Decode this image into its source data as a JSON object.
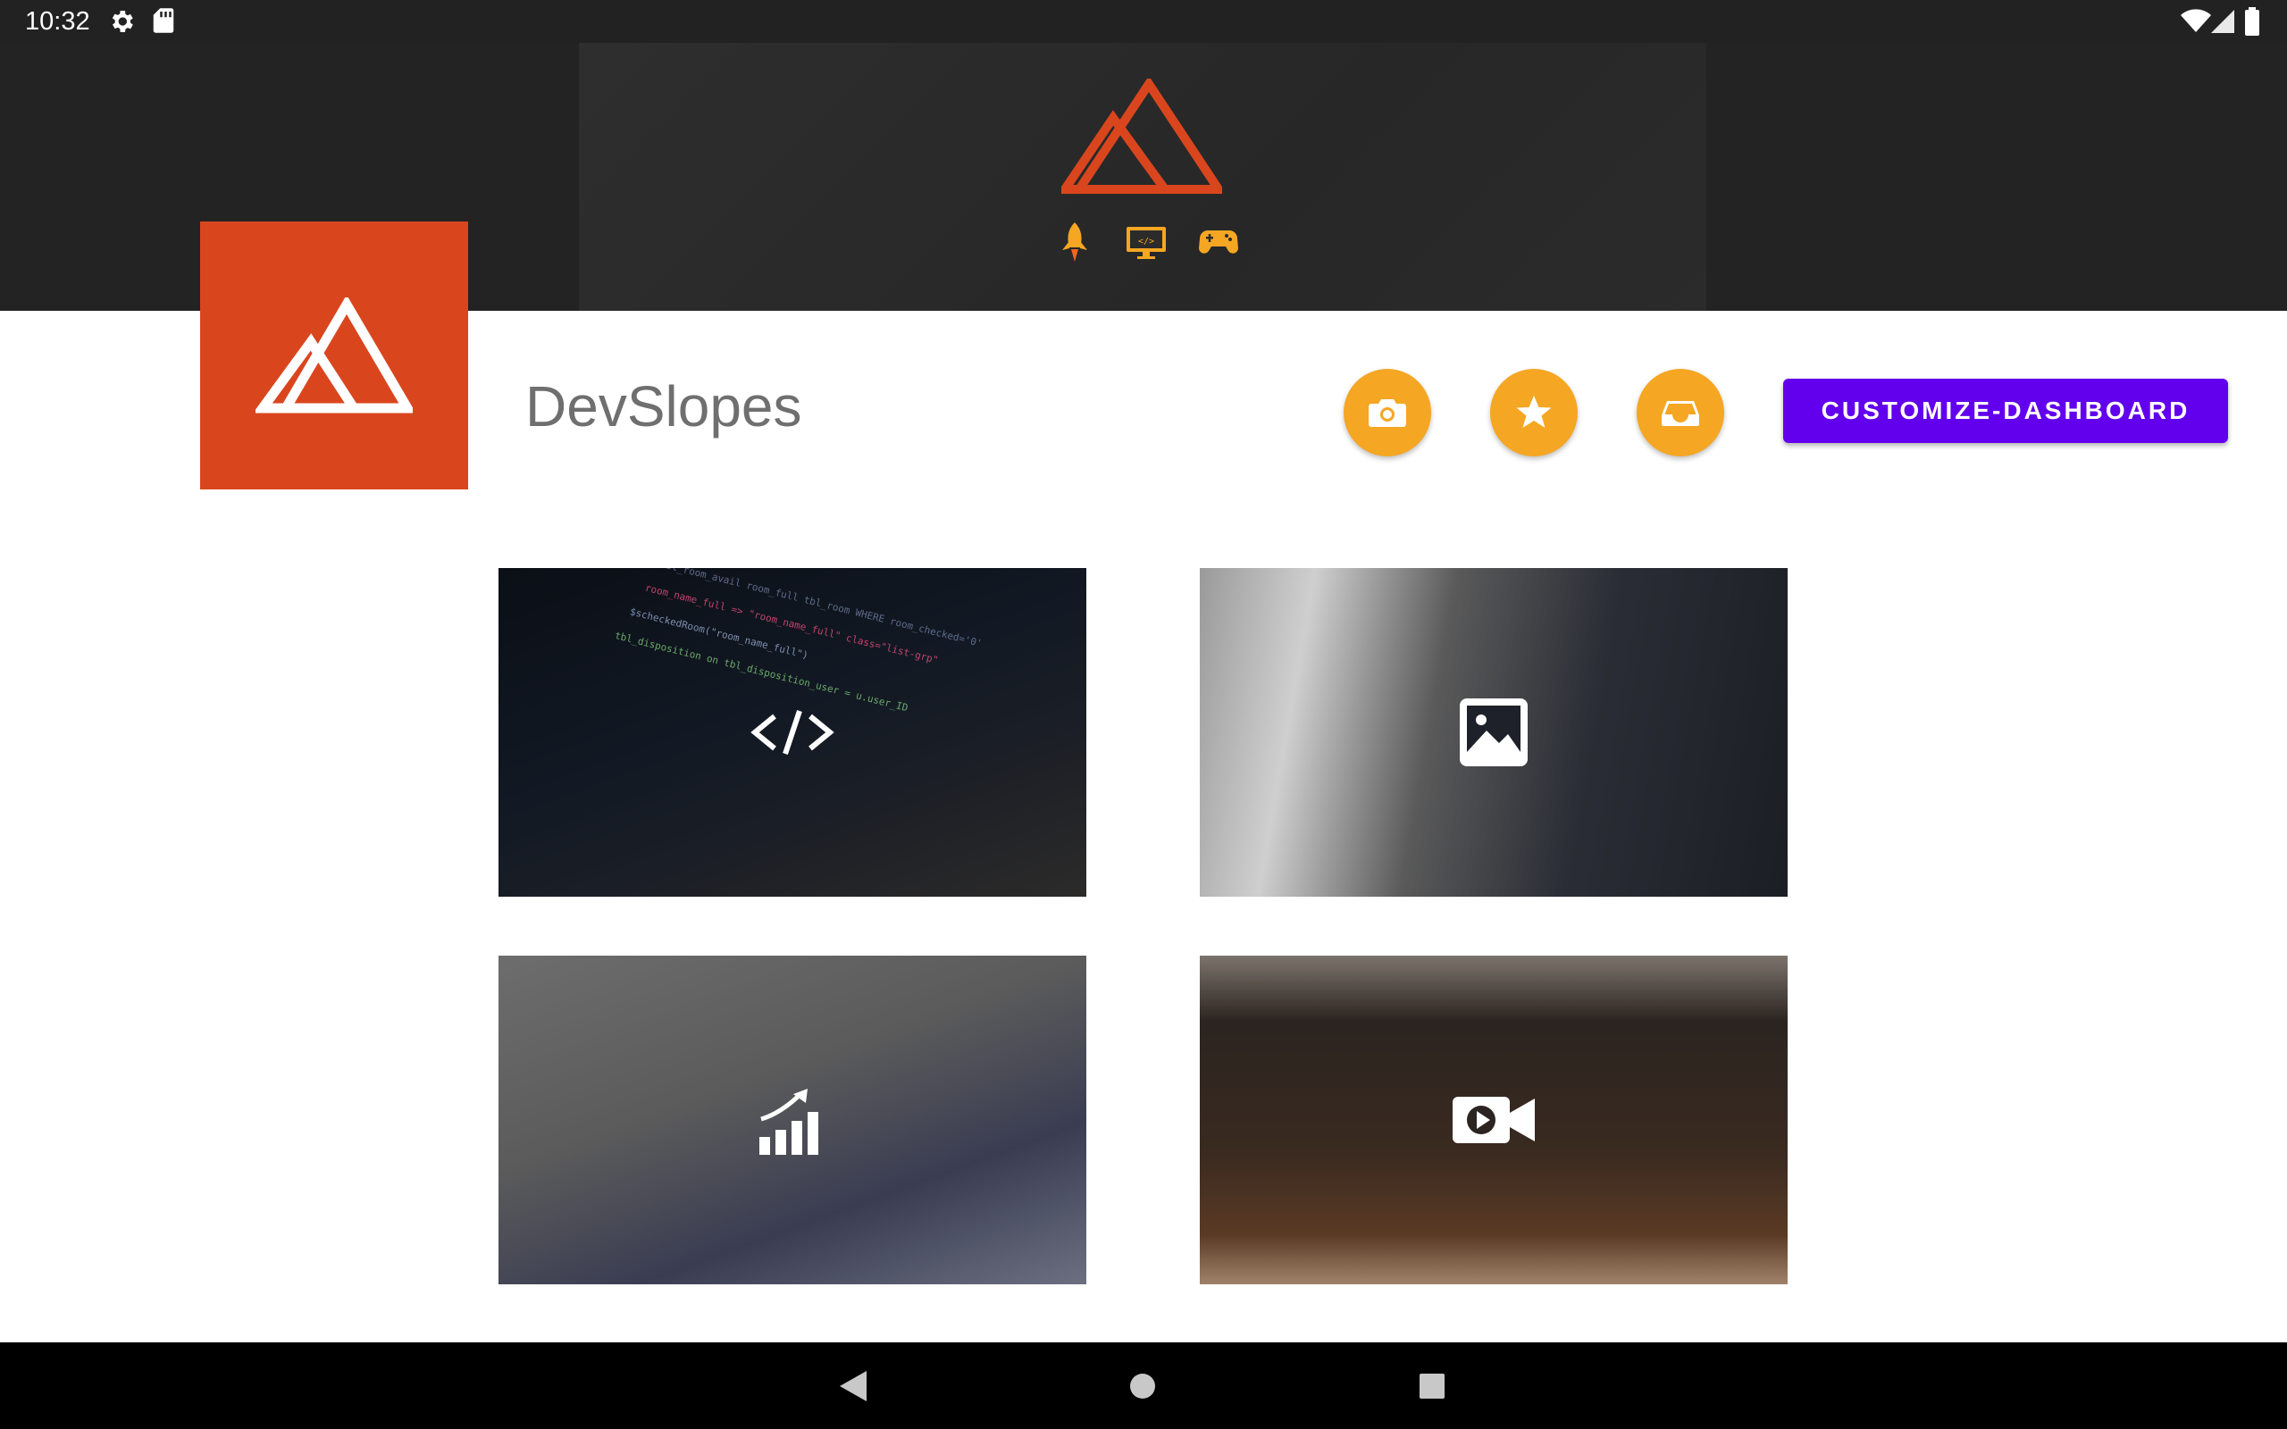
{
  "status_bar": {
    "time": "10:32",
    "icons": [
      "settings-icon",
      "sd-card-icon",
      "wifi-icon",
      "signal-icon",
      "battery-icon"
    ]
  },
  "header": {
    "banner_icons": [
      "mountain-logo-icon",
      "rocket-icon",
      "code-monitor-icon",
      "gamepad-icon"
    ],
    "logo_color": "#d9461e"
  },
  "profile": {
    "title": "DevSlopes"
  },
  "actions": {
    "buttons": [
      {
        "icon": "camera-icon",
        "color": "#f5a623"
      },
      {
        "icon": "star-icon",
        "color": "#f5a623"
      },
      {
        "icon": "inbox-icon",
        "color": "#f5a623"
      }
    ],
    "customize_label": "CUSTOMIZE-DASHBOARD",
    "customize_color": "#6200ee"
  },
  "tiles": [
    {
      "icon": "code-icon"
    },
    {
      "icon": "image-icon"
    },
    {
      "icon": "chart-icon"
    },
    {
      "icon": "video-icon"
    }
  ],
  "nav_bar": {
    "icons": [
      "back-icon",
      "home-icon",
      "recents-icon"
    ]
  }
}
